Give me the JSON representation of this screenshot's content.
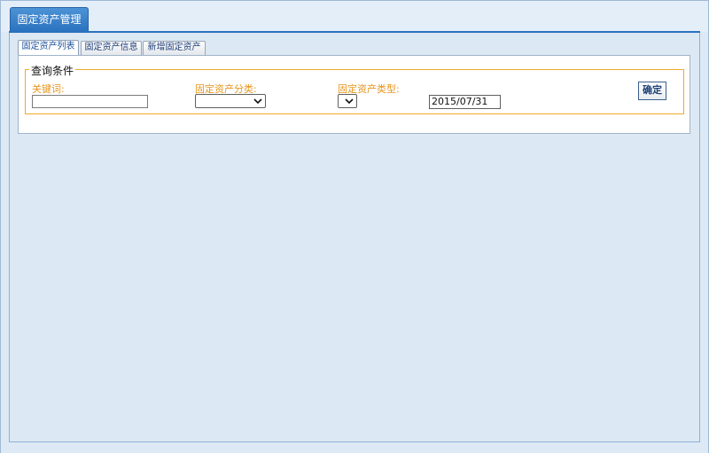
{
  "main_tab": {
    "label": "固定资产管理"
  },
  "sub_tabs": [
    {
      "label": "固定资产列表",
      "active": true
    },
    {
      "label": "固定资产信息",
      "active": false
    },
    {
      "label": "新增固定资产",
      "active": false
    }
  ],
  "query": {
    "legend": "查询条件",
    "keyword": {
      "label": "关键词:",
      "value": ""
    },
    "category": {
      "label": "固定资产分类:",
      "selected": ""
    },
    "type": {
      "label": "固定资产类型:",
      "selected": ""
    },
    "date": {
      "value": "2015/07/31"
    },
    "confirm_label": "确定"
  },
  "colors": {
    "accent": "#2a72bf",
    "label_orange": "#e7951c",
    "background": "#dde9f5"
  }
}
